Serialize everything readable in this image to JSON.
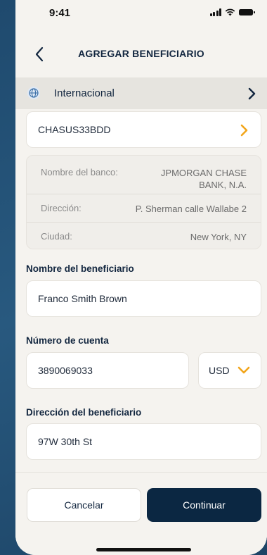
{
  "status_bar": {
    "time": "9:41"
  },
  "header": {
    "title": "AGREGAR BENEFICIARIO"
  },
  "account_type": {
    "label": "Internacional",
    "icon": "globe-icon"
  },
  "swift": {
    "value": "CHASUS33BDD"
  },
  "bank_info": {
    "rows": [
      {
        "label": "Nombre del banco:",
        "value": "JPMORGAN CHASE BANK, N.A."
      },
      {
        "label": "Dirección:",
        "value": "P. Sherman calle Wallabe 2"
      },
      {
        "label": "Ciudad:",
        "value": "New York, NY"
      }
    ]
  },
  "form": {
    "beneficiary_name": {
      "label": "Nombre del beneficiario",
      "value": "Franco Smith Brown"
    },
    "account_number": {
      "label": "Número de cuenta",
      "value": "3890069033",
      "currency": "USD"
    },
    "beneficiary_address": {
      "label": "Dirección del beneficiario",
      "value": "97W 30th St"
    }
  },
  "actions": {
    "cancel": "Cancelar",
    "continue": "Continuar"
  },
  "colors": {
    "primary": "#0b2742",
    "accent": "#f2a51a",
    "background": "#f5f3ef"
  }
}
